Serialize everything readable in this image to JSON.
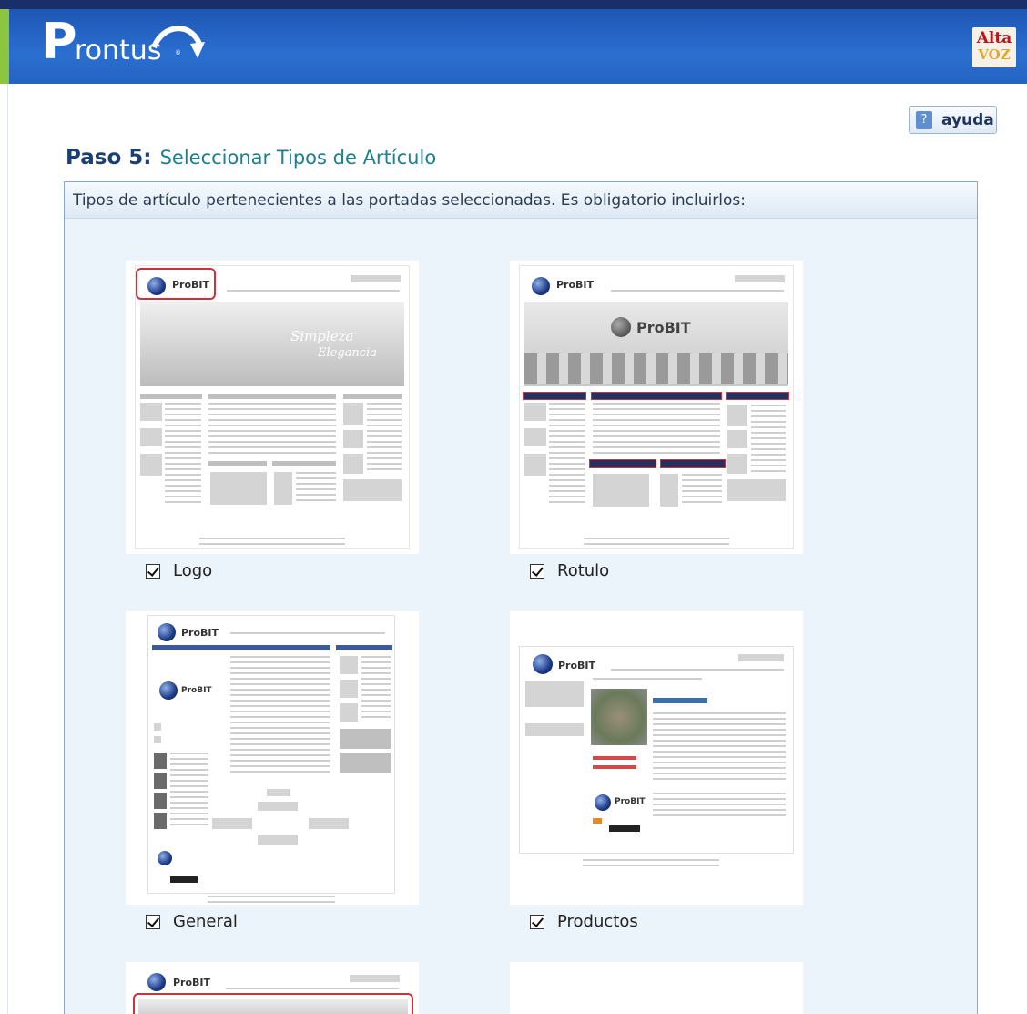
{
  "header": {
    "app_logo": "Prontus",
    "app_logo_first": "P",
    "app_logo_rest": "rontus",
    "app_logo_mark": "®",
    "brand_badge_top": "Alta",
    "brand_badge_bottom": "VOZ"
  },
  "help": {
    "label": "ayuda",
    "icon": "question-icon",
    "icon_glyph": "?"
  },
  "step": {
    "number_label": "Paso 5:",
    "title": "Seleccionar Tipos de Artículo"
  },
  "panel": {
    "description": "Tipos de artículo pertenecientes a las portadas seleccionadas. Es obligatorio incluirlos:"
  },
  "thumb_brand": "ProBIT",
  "thumb_texts": {
    "hero_line1": "Simpleza",
    "hero_line2": "Elegancia"
  },
  "article_types": [
    {
      "label": "Logo",
      "checked": true
    },
    {
      "label": "Rotulo",
      "checked": true
    },
    {
      "label": "General",
      "checked": true
    },
    {
      "label": "Productos",
      "checked": true
    }
  ],
  "colors": {
    "header_blue": "#2563c1",
    "accent_green": "#8cc63f",
    "panel_border": "#84a9cc",
    "highlight_red": "#d0303a"
  }
}
